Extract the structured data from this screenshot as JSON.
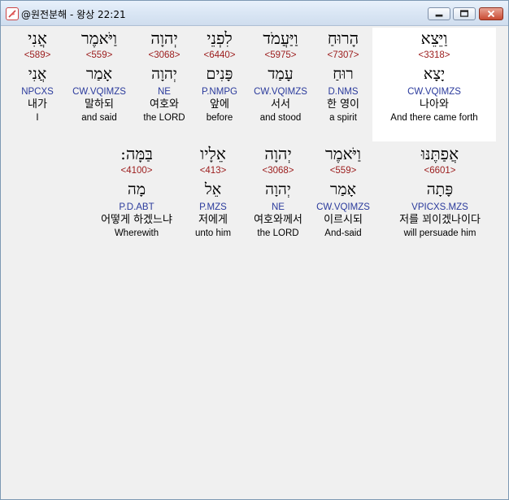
{
  "window": {
    "title": "@원전분해 - 왕상 22:21",
    "icon": "app-feather-icon",
    "controls": [
      "minimize-icon",
      "maximize-icon",
      "close-icon"
    ]
  },
  "colors": {
    "strong_number": "#9b1b1b",
    "morphology": "#2a3a9c",
    "highlight_bg": "#ffffff"
  },
  "rows": [
    {
      "words": [
        {
          "hebrew": "וַיֵּצֵא",
          "strong": "<3318>",
          "lemma": "יָצָא",
          "morph": "CW.VQIMZS",
          "korean": "나아와",
          "english": "And there came forth",
          "highlighted": true
        },
        {
          "hebrew": "הָרוּחַ",
          "strong": "<7307>",
          "lemma": "רוּחַ",
          "morph": "D.NMS",
          "korean": "한 영이",
          "english": "a spirit"
        },
        {
          "hebrew": "וַיַּעֲמֹד",
          "strong": "<5975>",
          "lemma": "עָמַד",
          "morph": "CW.VQIMZS",
          "korean": "서서",
          "english": "and stood"
        },
        {
          "hebrew": "לִפְנֵי",
          "strong": "<6440>",
          "lemma": "פָּנִים",
          "morph": "P.NMPG",
          "korean": "앞에",
          "english": "before"
        },
        {
          "hebrew": "יְהוָה",
          "strong": "<3068>",
          "lemma": "יְהוָה",
          "morph": "NE",
          "korean": "여호와",
          "english": "the LORD"
        },
        {
          "hebrew": "וַיֹּאמֶר",
          "strong": "<559>",
          "lemma": "אָמַר",
          "morph": "CW.VQIMZS",
          "korean": "말하되",
          "english": "and said"
        },
        {
          "hebrew": "אֲנִי",
          "strong": "<589>",
          "lemma": "אֲנִי",
          "morph": "NPCXS",
          "korean": "내가",
          "english": "I"
        }
      ]
    },
    {
      "words": [
        {
          "hebrew": "אֲפַתֶּנּוּ",
          "strong": "<6601>",
          "lemma": "פָּתָה",
          "morph": "VPICXS.MZS",
          "korean": "저를 꾀이겠나이다",
          "english": "will persuade him"
        },
        {
          "hebrew": "וַיֹּאמֶר",
          "strong": "<559>",
          "lemma": "אָמַר",
          "morph": "CW.VQIMZS",
          "korean": "이르시되",
          "english": "And-said"
        },
        {
          "hebrew": "יְהוָה",
          "strong": "<3068>",
          "lemma": "יְהוָה",
          "morph": "NE",
          "korean": "여호와께서",
          "english": "the LORD"
        },
        {
          "hebrew": "אֵלָיו",
          "strong": "<413>",
          "lemma": "אֵל",
          "morph": "P.MZS",
          "korean": "저에게",
          "english": "unto him"
        },
        {
          "hebrew": "בַּמָּה:",
          "strong": "<4100>",
          "lemma": "מָה",
          "morph": "P.D.ABT",
          "korean": "어떻게 하겠느냐",
          "english": "Wherewith"
        }
      ]
    }
  ]
}
